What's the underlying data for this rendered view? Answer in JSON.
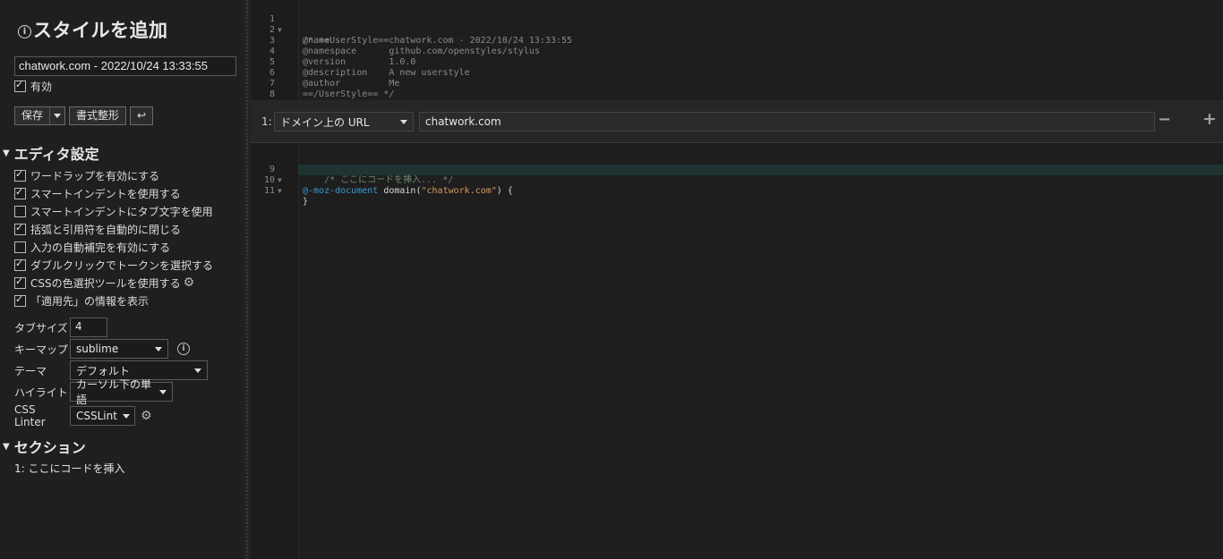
{
  "sidebar": {
    "title": "スタイルを追加",
    "name_value": "chatwork.com - 2022/10/24 13:33:55",
    "enabled_label": "有効",
    "buttons": {
      "save": "保存",
      "format": "書式整形",
      "undo_symbol": "↩"
    },
    "editor_settings_heading": "エディタ設定",
    "options": [
      {
        "label": "ワードラップを有効にする",
        "checked": true
      },
      {
        "label": "スマートインデントを使用する",
        "checked": true
      },
      {
        "label": "スマートインデントにタブ文字を使用",
        "checked": false
      },
      {
        "label": "括弧と引用符を自動的に閉じる",
        "checked": true
      },
      {
        "label": "入力の自動補完を有効にする",
        "checked": false
      },
      {
        "label": "ダブルクリックでトークンを選択する",
        "checked": true
      },
      {
        "label": "CSSの色選択ツールを使用する",
        "checked": true
      },
      {
        "label": "「適用先」の情報を表示",
        "checked": true
      }
    ],
    "tabsize_label": "タブサイズ",
    "tabsize_value": "4",
    "keymap_label": "キーマップ",
    "keymap_value": "sublime",
    "theme_label": "テーマ",
    "theme_value": "デフォルト",
    "highlight_label": "ハイライト",
    "highlight_value": "カーソル下の単語",
    "linter_label": "CSS Linter",
    "linter_value": "CSSLint",
    "sections_heading": "セクション",
    "section_item": "1: ここにコードを挿入"
  },
  "editor": {
    "meta_lines": [
      {
        "n": "1",
        "text": "/* ==UserStyle==",
        "fold": true
      },
      {
        "n": "2",
        "text": "@name           chatwork.com - 2022/10/24 13:33:55",
        "fold": false
      },
      {
        "n": "3",
        "text": "@namespace      github.com/openstyles/stylus",
        "fold": false
      },
      {
        "n": "4",
        "text": "@version        1.0.0",
        "fold": false
      },
      {
        "n": "5",
        "text": "@description    A new userstyle",
        "fold": false
      },
      {
        "n": "6",
        "text": "@author         Me",
        "fold": false
      },
      {
        "n": "7",
        "text": "==/UserStyle== */",
        "fold": false
      },
      {
        "n": "8",
        "text": "",
        "fold": false
      }
    ],
    "applies": {
      "index": "1:",
      "type_value": "ドメイン上の URL",
      "value": "chatwork.com",
      "remove_symbol": "−",
      "add_symbol": "+"
    },
    "code_lines": [
      {
        "n": "9",
        "fold": true
      },
      {
        "n": "10",
        "fold": true
      },
      {
        "n": "11",
        "fold": false
      }
    ],
    "code": {
      "l9_kw": "@-moz-document",
      "l9_fn": "domain(",
      "l9_str": "\"chatwork.com\"",
      "l9_end": ") {",
      "l10": "    /* ここにコードを挿入... */",
      "l11": "}"
    }
  },
  "colors": {
    "background": "#1e1e1e",
    "sidebar": "#1f1f1f",
    "keyword": "#3a9bd6",
    "string": "#d89b5a",
    "active_line": "#1e3332"
  }
}
